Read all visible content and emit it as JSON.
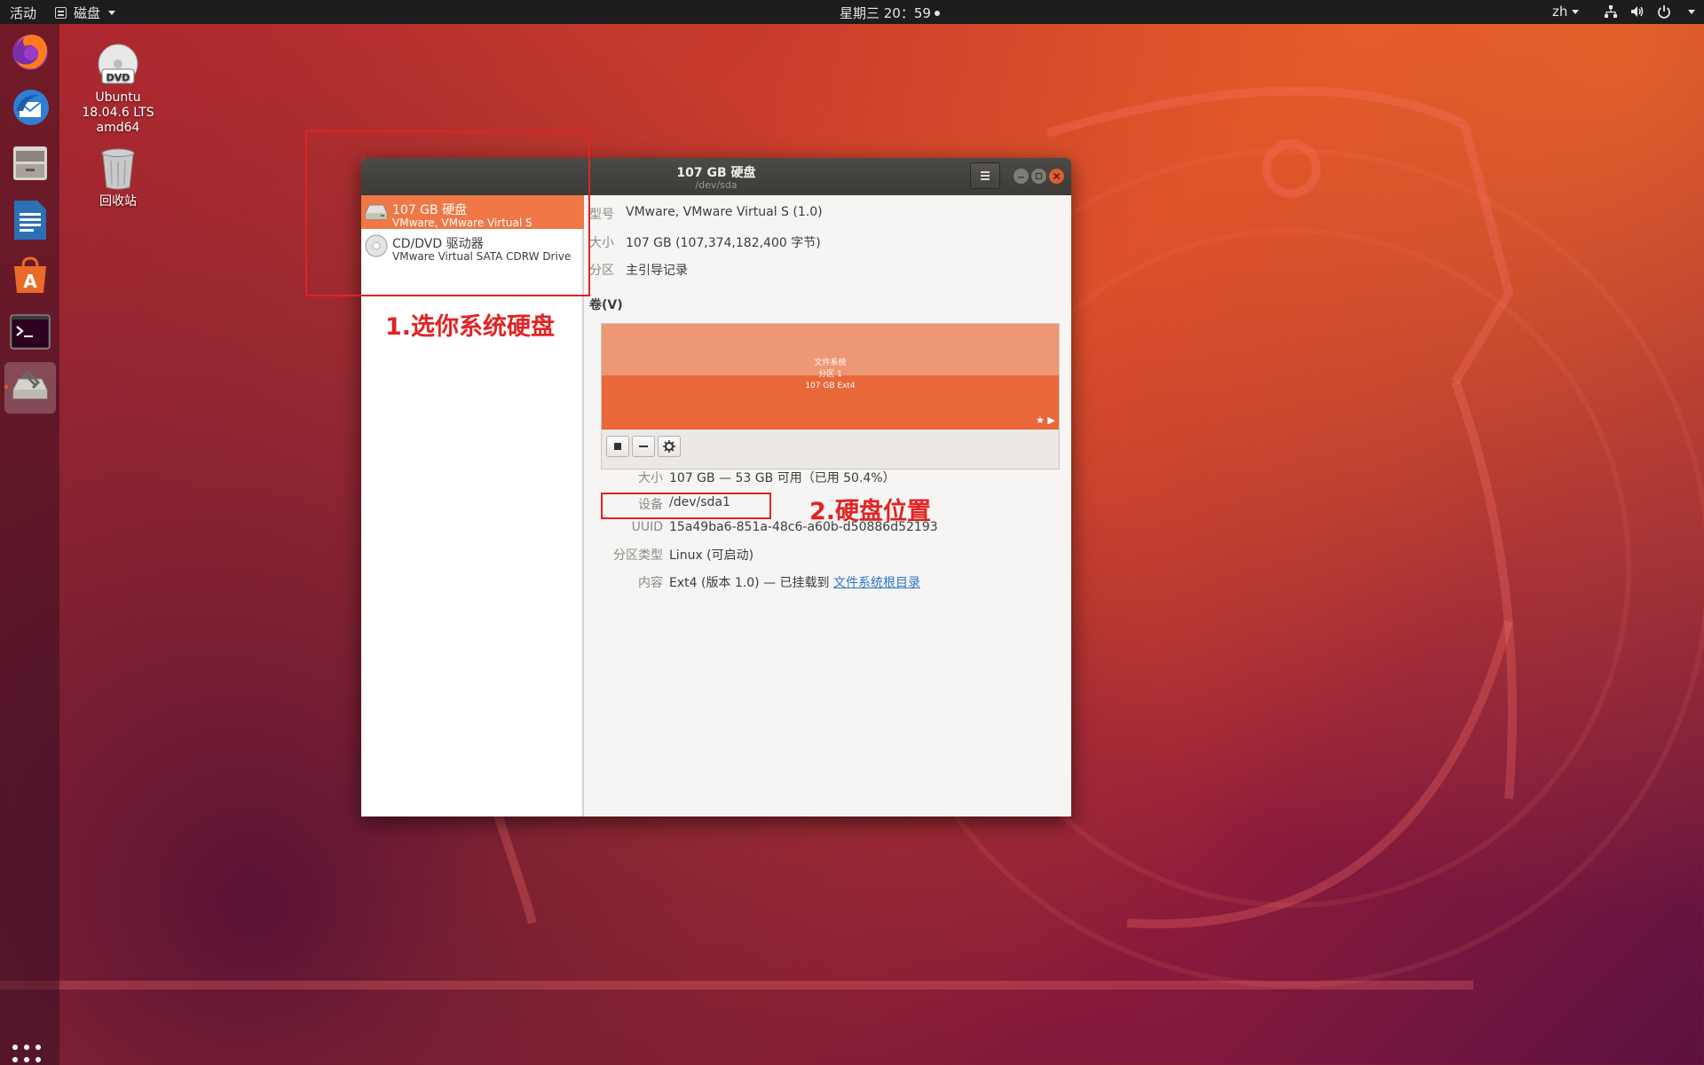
{
  "topbar": {
    "activities": "活动",
    "app_name": "磁盘",
    "clock": "星期三 20：59",
    "lang": "zh"
  },
  "desktop": {
    "dvd_label_1": "Ubuntu",
    "dvd_label_2": "18.04.6 LTS",
    "dvd_label_3": "amd64",
    "trash_label": "回收站"
  },
  "dock": {
    "items": [
      "firefox-icon",
      "thunderbird-icon",
      "files-icon",
      "writer-icon",
      "software-icon",
      "terminal-icon",
      "disks-icon"
    ],
    "accent": "#e95420"
  },
  "window": {
    "title": "107 GB 硬盘",
    "subtitle": "/dev/sda"
  },
  "drives": [
    {
      "name": "107 GB 硬盘",
      "sub": "VMware, VMware Virtual S"
    },
    {
      "name": "CD/DVD 驱动器",
      "sub": "VMware Virtual SATA CDRW Drive"
    }
  ],
  "disk_info": {
    "model_label": "型号",
    "model_value": "VMware, VMware Virtual S (1.0)",
    "size_label": "大小",
    "size_value": "107 GB (107,374,182,400 字节)",
    "partition_label": "分区",
    "partition_value": "主引导记录"
  },
  "volumes": {
    "section_label": "卷(V)",
    "bar_line1": "文件系统",
    "bar_line2": "分区 1",
    "bar_line3": "107 GB Ext4",
    "bar_color": "#e9683a"
  },
  "part_info": {
    "size_label": "大小",
    "size_value": "107 GB — 53 GB 可用（已用 50.4%）",
    "device_label": "设备",
    "device_value": "/dev/sda1",
    "uuid_label": "UUID",
    "uuid_value": "15a49ba6-851a-48c6-a60b-d50886d52193",
    "type_label": "分区类型",
    "type_value": "Linux (可启动)",
    "content_label": "内容",
    "content_value": "Ext4 (版本 1.0) — 已挂载到",
    "content_link": "文件系统根目录"
  },
  "annotations": {
    "step1": "1.选你系统硬盘",
    "step2": "2.硬盘位置",
    "color": "#e22323"
  }
}
